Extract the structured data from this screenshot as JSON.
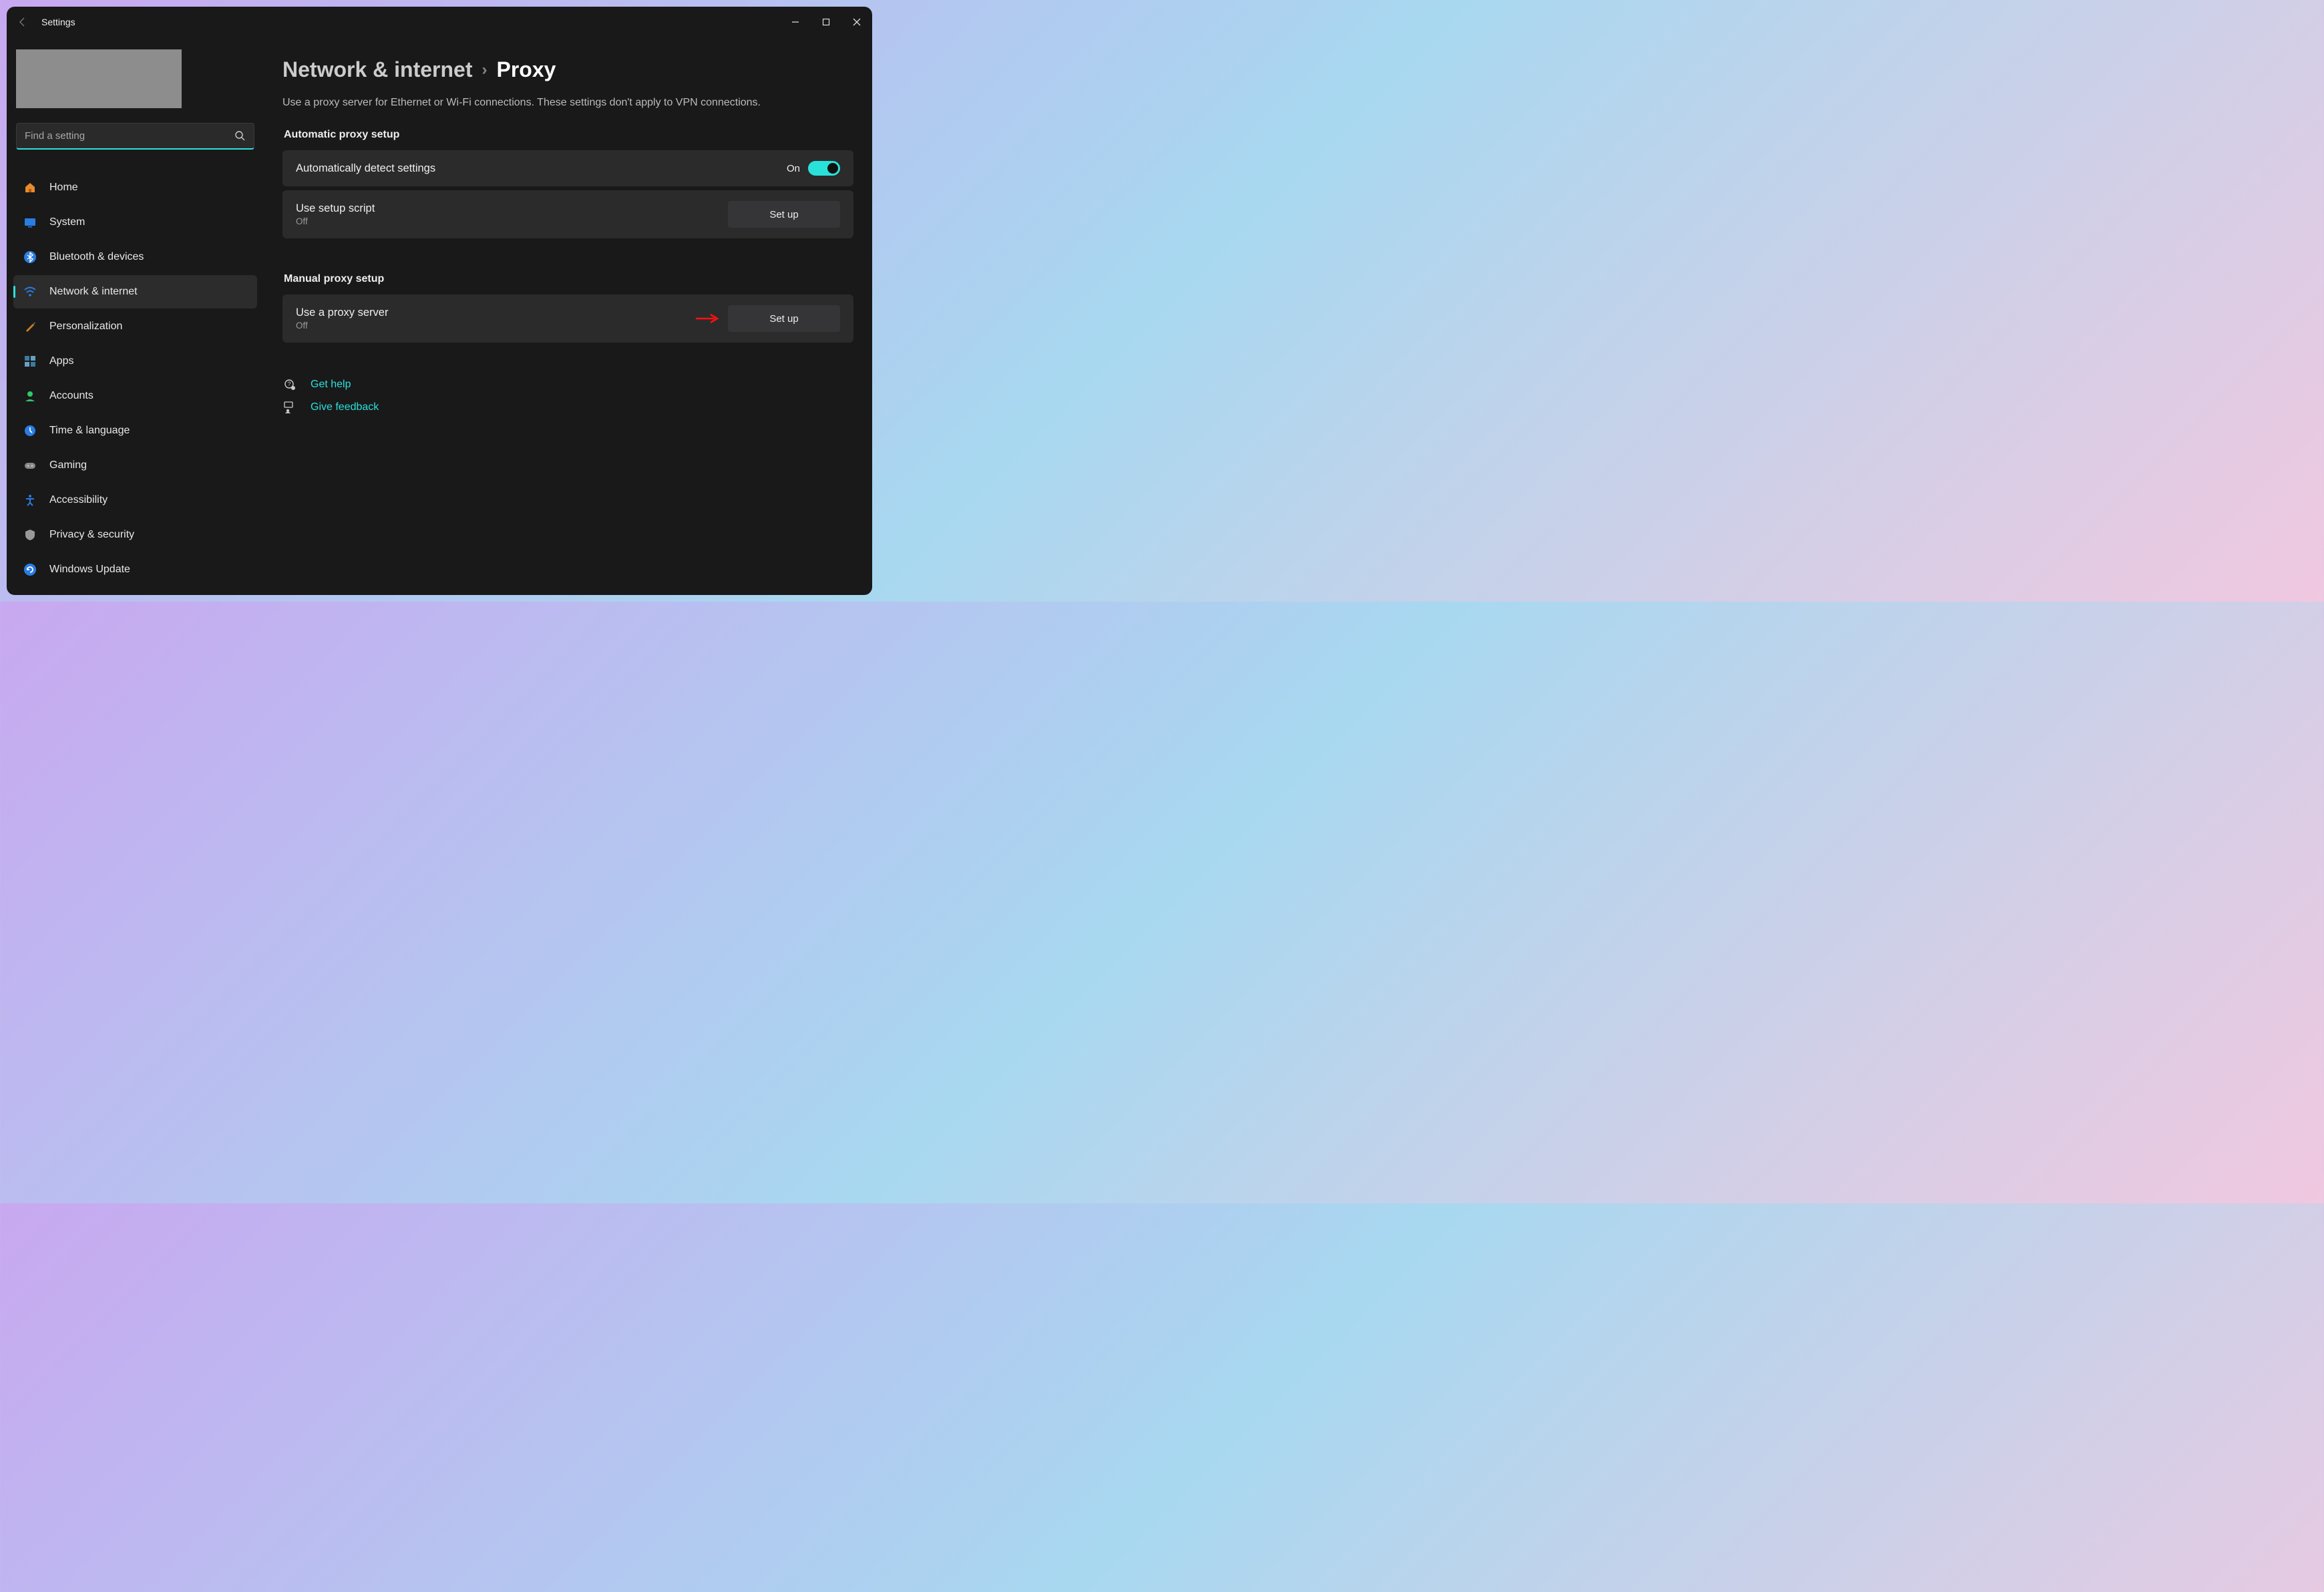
{
  "window": {
    "title": "Settings"
  },
  "search": {
    "placeholder": "Find a setting"
  },
  "sidebar": {
    "items": [
      {
        "label": "Home"
      },
      {
        "label": "System"
      },
      {
        "label": "Bluetooth & devices"
      },
      {
        "label": "Network & internet"
      },
      {
        "label": "Personalization"
      },
      {
        "label": "Apps"
      },
      {
        "label": "Accounts"
      },
      {
        "label": "Time & language"
      },
      {
        "label": "Gaming"
      },
      {
        "label": "Accessibility"
      },
      {
        "label": "Privacy & security"
      },
      {
        "label": "Windows Update"
      }
    ]
  },
  "breadcrumb": {
    "parent": "Network & internet",
    "current": "Proxy"
  },
  "subtitle": "Use a proxy server for Ethernet or Wi-Fi connections. These settings don't apply to VPN connections.",
  "sections": {
    "auto": {
      "title": "Automatic proxy setup",
      "detect": {
        "label": "Automatically detect settings",
        "state_label": "On"
      },
      "script": {
        "label": "Use setup script",
        "status": "Off",
        "button": "Set up"
      }
    },
    "manual": {
      "title": "Manual proxy setup",
      "server": {
        "label": "Use a proxy server",
        "status": "Off",
        "button": "Set up"
      }
    }
  },
  "links": {
    "help": "Get help",
    "feedback": "Give feedback"
  }
}
